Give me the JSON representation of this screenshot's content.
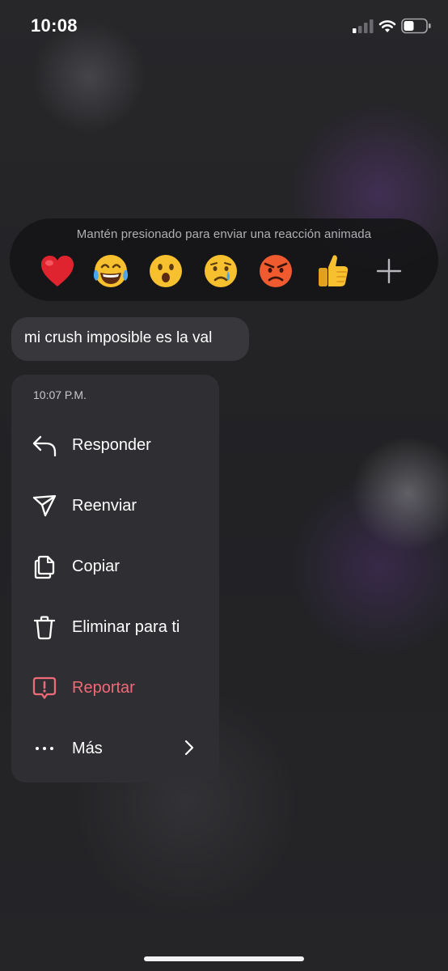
{
  "status_bar": {
    "time": "10:08"
  },
  "reaction_bar": {
    "hint": "Mantén presionado para enviar una reacción animada",
    "reactions": [
      {
        "name": "red-heart",
        "glyph": "❤️"
      },
      {
        "name": "tears-of-joy",
        "glyph": "😂"
      },
      {
        "name": "surprised",
        "glyph": "😮"
      },
      {
        "name": "crying",
        "glyph": "😢"
      },
      {
        "name": "angry",
        "glyph": "😡"
      },
      {
        "name": "thumbs-up",
        "glyph": "👍"
      }
    ],
    "add_icon": "plus-icon"
  },
  "message": {
    "text": "mi crush imposible es la val"
  },
  "context_menu": {
    "timestamp": "10:07 P.M.",
    "items": [
      {
        "label": "Responder",
        "icon": "reply-icon"
      },
      {
        "label": "Reenviar",
        "icon": "send-icon"
      },
      {
        "label": "Copiar",
        "icon": "copy-icon"
      },
      {
        "label": "Eliminar para ti",
        "icon": "trash-icon"
      },
      {
        "label": "Reportar",
        "icon": "report-icon",
        "color": "#ef6a77"
      },
      {
        "label": "Más",
        "icon": "more-icon",
        "trailing_icon": "chevron-right-icon"
      }
    ]
  },
  "colors": {
    "background": "#232326",
    "menu_background": "#2f2f33",
    "bubble_background": "#38383c",
    "danger": "#ef6a77"
  }
}
